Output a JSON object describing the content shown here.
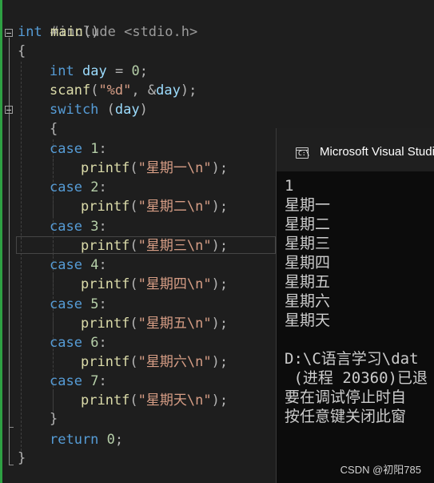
{
  "editor": {
    "include": {
      "directive": "#include",
      "header": "<stdio.h>"
    },
    "main_sig": {
      "type": "int",
      "name": "main",
      "parens": "()"
    },
    "open_brace": "{",
    "decl": {
      "type": "int",
      "name": "day",
      "eq": "=",
      "value": "0",
      "end": ";"
    },
    "scanf": {
      "fn": "scanf",
      "open": "(",
      "fmt": "\"%d\"",
      "sep": ", &",
      "arg": "day",
      "close": ");"
    },
    "switch": {
      "kw": "switch",
      "open": "(",
      "arg": "day",
      "close": ")"
    },
    "switch_open": "{",
    "cases": [
      {
        "kw": "case",
        "num": "1",
        "colon": ":",
        "fn": "printf",
        "open": "(",
        "str": "\"星期一\\n\"",
        "close": ");"
      },
      {
        "kw": "case",
        "num": "2",
        "colon": ":",
        "fn": "printf",
        "open": "(",
        "str": "\"星期二\\n\"",
        "close": ");"
      },
      {
        "kw": "case",
        "num": "3",
        "colon": ":",
        "fn": "printf",
        "open": "(",
        "str": "\"星期三\\n\"",
        "close": ");"
      },
      {
        "kw": "case",
        "num": "4",
        "colon": ":",
        "fn": "printf",
        "open": "(",
        "str": "\"星期四\\n\"",
        "close": ");"
      },
      {
        "kw": "case",
        "num": "5",
        "colon": ":",
        "fn": "printf",
        "open": "(",
        "str": "\"星期五\\n\"",
        "close": ");"
      },
      {
        "kw": "case",
        "num": "6",
        "colon": ":",
        "fn": "printf",
        "open": "(",
        "str": "\"星期六\\n\"",
        "close": ");"
      },
      {
        "kw": "case",
        "num": "7",
        "colon": ":",
        "fn": "printf",
        "open": "(",
        "str": "\"星期天\\n\"",
        "close": ");"
      }
    ],
    "switch_close": "}",
    "ret": {
      "kw": "return",
      "value": "0",
      "end": ";"
    },
    "close_brace": "}"
  },
  "console": {
    "title": "Microsoft Visual Studio",
    "lines": [
      "1",
      "星期一",
      "星期二",
      "星期三",
      "星期四",
      "星期五",
      "星期六",
      "星期天",
      "",
      "D:\\C语言学习\\dat",
      " (进程 20360)已退",
      "要在调试停止时自",
      "按任意键关闭此窗"
    ]
  },
  "watermark": "CSDN @初阳785",
  "colors": {
    "keyword": "#569cd6",
    "string": "#d69d85",
    "number": "#b5cea8",
    "function": "#dcdcaa",
    "variable": "#9cdcfe",
    "git_bar": "#2ea043",
    "background": "#1e1e1e",
    "console_bg": "#0c0c0c"
  },
  "icons": {
    "fold_toggle": "minus-box-icon",
    "console_app": "console-window-icon"
  }
}
